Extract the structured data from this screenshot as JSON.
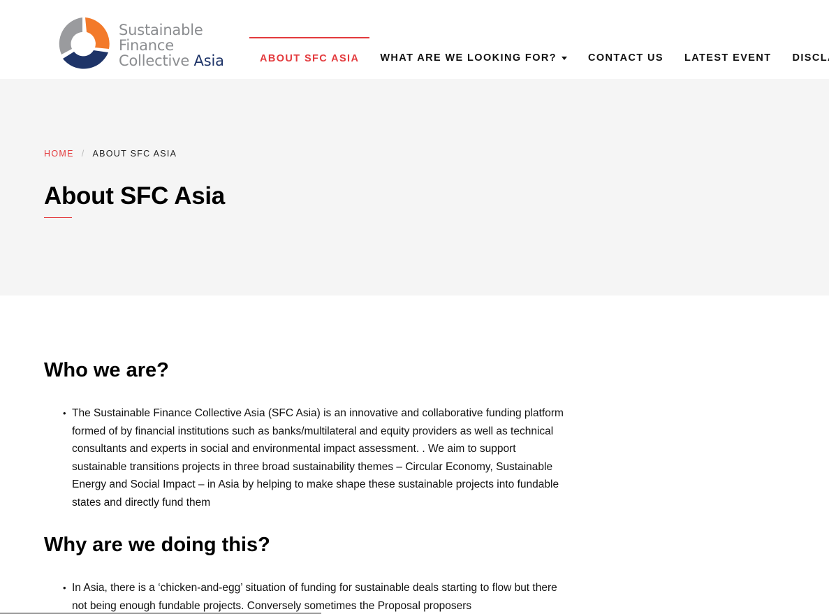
{
  "logo": {
    "line1": "Sustainable",
    "line2": "Finance",
    "line3_a": "Collective",
    "line3_b": "Asia",
    "colors": {
      "orange": "#f37a2a",
      "navy": "#1e3468",
      "grey": "#9a9b9e"
    }
  },
  "nav": {
    "items": [
      {
        "label": "ABOUT SFC ASIA",
        "active": true
      },
      {
        "label": "WHAT ARE WE LOOKING FOR?",
        "has_dropdown": true
      },
      {
        "label": "CONTACT US"
      },
      {
        "label": "LATEST EVENT"
      },
      {
        "label": "DISCLAIMER"
      }
    ]
  },
  "breadcrumb": {
    "home": "HOME",
    "separator": "/",
    "current": "ABOUT SFC ASIA"
  },
  "page": {
    "title": "About SFC Asia"
  },
  "sections": [
    {
      "heading": "Who we are?",
      "bullets": [
        "The Sustainable Finance Collective Asia (SFC Asia) is an innovative and collaborative funding platform formed of by financial institutions such as banks/multilateral and equity providers as well as technical consultants and experts in social and environmental impact assessment. . We aim to support sustainable transitions projects in three broad sustainability themes – Circular Economy, Sustainable Energy and Social Impact – in Asia by helping to make shape these sustainable projects into fundable states and directly fund them"
      ]
    },
    {
      "heading": "Why are we doing this?",
      "bullets": [
        "In Asia, there is a ‘chicken-and-egg’ situation of funding for sustainable deals starting to flow but there not being enough fundable projects. Conversely sometimes the Proposal proposers"
      ]
    }
  ],
  "theme": {
    "accent": "#e33a3d",
    "hero_bg": "#f5f5f5"
  }
}
